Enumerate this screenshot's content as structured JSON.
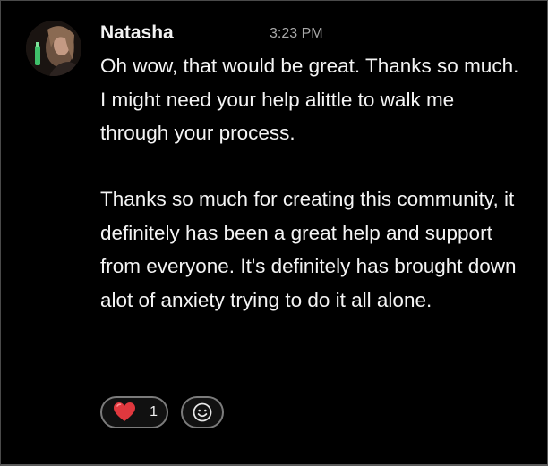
{
  "message": {
    "author": "Natasha",
    "timestamp": "3:23 PM",
    "paragraphs": [
      "Oh wow, that would be great. Thanks so much. I might need your help alittle to walk me through your process.",
      "Thanks so much for creating this community, it definitely has been a great help and support from everyone. It's definitely has brought down alot of anxiety trying to do it all alone."
    ]
  },
  "reactions": [
    {
      "emoji": "heart",
      "count": "1",
      "color": "#e0383e"
    }
  ],
  "add_reaction_icon": "smiley-add-reaction-icon",
  "colors": {
    "background": "#000000",
    "text": "#f4f4f4",
    "muted": "#a9a9a9",
    "pill_border": "#7b7b7b"
  }
}
